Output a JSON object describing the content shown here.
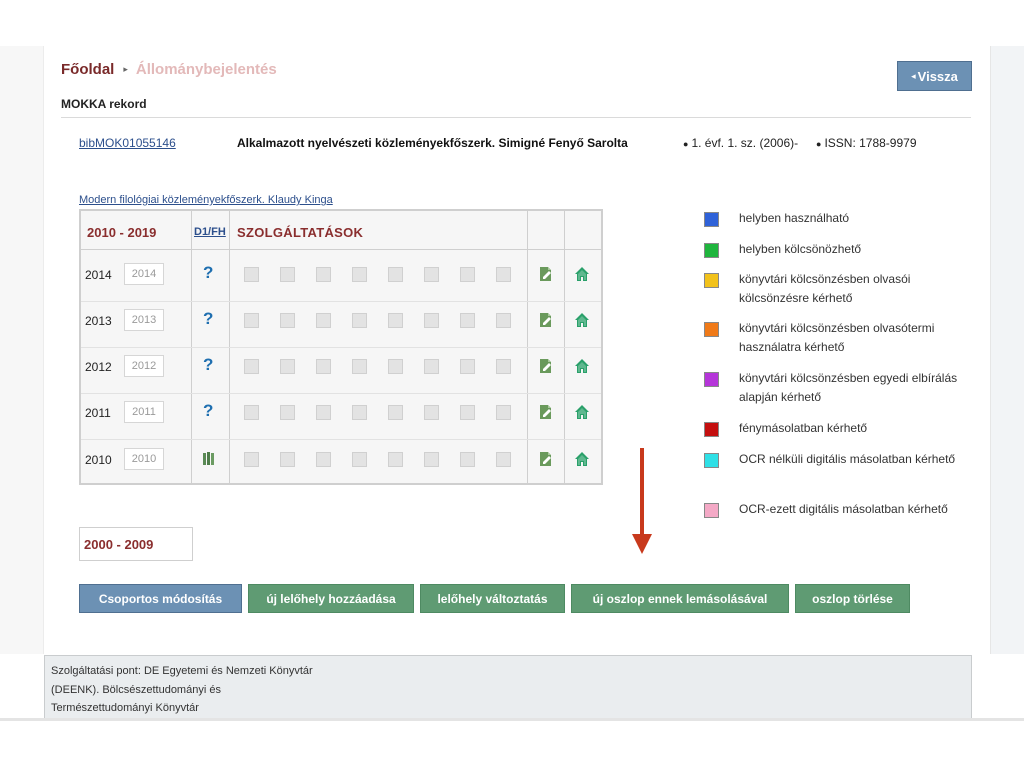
{
  "breadcrumb": {
    "home": "Főoldal",
    "separator": "▸",
    "current": "Állománybejelentés"
  },
  "header": {
    "back_button": "Vissza",
    "back_arrow": "◂"
  },
  "record": {
    "section_label": "MOKKA rekord",
    "id": "bibMOK01055146",
    "title": "Alkalmazott nyelvészeti közleményekfőszerk. Simigné Fenyő Sarolta",
    "edition_bullet": "●",
    "edition": "1. évf. 1. sz. (2006)-",
    "issn_bullet": "●",
    "issn": "ISSN: 1788-9979"
  },
  "holdings": {
    "sub_link": "Modern filológiai közleményekfőszerk. Klaudy Kinga",
    "decade_label": "2010 - 2019",
    "d1fh_label": "D1/FH",
    "services_label": "SZOLGÁLTATÁSOK",
    "rows": [
      {
        "year": "2014",
        "field_value": "2014",
        "status_icon": "question-icon"
      },
      {
        "year": "2013",
        "field_value": "2013",
        "status_icon": "question-icon"
      },
      {
        "year": "2012",
        "field_value": "2012",
        "status_icon": "question-icon"
      },
      {
        "year": "2011",
        "field_value": "2011",
        "status_icon": "question-icon"
      },
      {
        "year": "2010",
        "field_value": "2010",
        "status_icon": "books-icon"
      }
    ],
    "question_mark": "?",
    "decade2_label": "2000 - 2009"
  },
  "legend": [
    {
      "color": "#2f62d8",
      "text": "helyben használható"
    },
    {
      "color": "#1fb53d",
      "text": "helyben kölcsönözhető"
    },
    {
      "color": "#f2c21b",
      "text": "könyvtári kölcsönzésben olvasói kölcsönzésre kérhető"
    },
    {
      "color": "#f07a18",
      "text": "könyvtári kölcsönzésben olvasótermi használatra kérhető"
    },
    {
      "color": "#b535d9",
      "text": "könyvtári kölcsönzésben egyedi elbírálás alapján kérhető"
    },
    {
      "color": "#c40f0f",
      "text": "fénymásolatban kérhető"
    },
    {
      "color": "#2fe0e6",
      "text": "OCR nélküli digitális másolatban kérhető"
    },
    {
      "color": "#f4a9c6",
      "text": "OCR-ezett digitális másolatban kérhető"
    }
  ],
  "actions": {
    "group_edit": "Csoportos módosítás",
    "add_location": "új lelőhely hozzáadása",
    "change_location": "lelőhely változtatás",
    "copy_column": "új oszlop ennek lemásolásával",
    "delete_column": "oszlop törlése"
  },
  "footer": {
    "lines": [
      "Szolgáltatási pont: DE Egyetemi és Nemzeti Könyvtár",
      "(DEENK). Bölcsészettudományi és",
      "Természettudományi Könyvtár"
    ]
  },
  "colors": {
    "accent_maroon": "#8a2e2e",
    "link_blue": "#2c4f8c",
    "button_green": "#5f9b73",
    "button_blue": "#6c91b4",
    "arrow_red": "#c8391c"
  }
}
